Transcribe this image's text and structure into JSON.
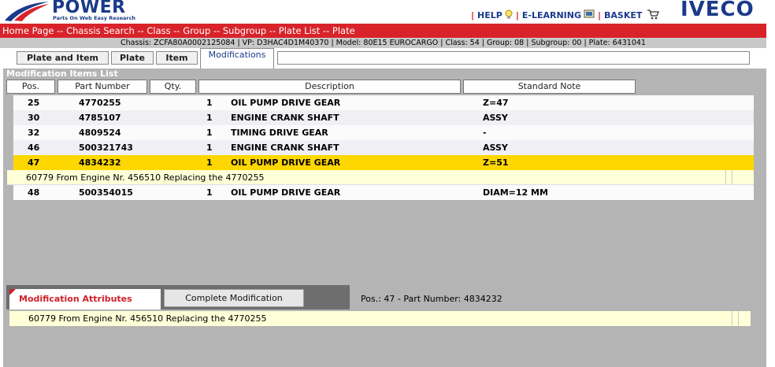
{
  "header": {
    "logo_text": "POWER",
    "logo_sub": "Parts On Web Easy Research",
    "help_label": "HELP",
    "elearning_label": "E-LEARNING",
    "basket_label": "BASKET",
    "brand": "IVECO"
  },
  "breadcrumb": "Home Page -- Chassis Search -- Class -- Group -- Subgroup -- Plate List -- Plate",
  "chassis_info": "Chassis: ZCFA80A0002125084 | VP: D3HAC4D1M40370 | Model: 80E15 EUROCARGO | Class: 54 | Group: 08 | Subgroup: 00 | Plate: 6431041",
  "tabs": [
    {
      "label": "Plate and Item"
    },
    {
      "label": "Plate"
    },
    {
      "label": "Item"
    },
    {
      "label": "Modifications"
    }
  ],
  "list": {
    "title": "Modification Items List",
    "columns": [
      "Pos.",
      "Part Number",
      "Qty.",
      "Description",
      "Standard Note"
    ],
    "rows": [
      {
        "pos": "25",
        "part": "4770255",
        "qty": "1",
        "desc": "OIL PUMP DRIVE GEAR",
        "note": "Z=47"
      },
      {
        "pos": "30",
        "part": "4785107",
        "qty": "1",
        "desc": "ENGINE CRANK SHAFT",
        "note": "ASSY"
      },
      {
        "pos": "32",
        "part": "4809524",
        "qty": "1",
        "desc": "TIMING DRIVE GEAR",
        "note": "-"
      },
      {
        "pos": "46",
        "part": "500321743",
        "qty": "1",
        "desc": "ENGINE CRANK SHAFT",
        "note": "ASSY"
      },
      {
        "pos": "47",
        "part": "4834232",
        "qty": "1",
        "desc": "OIL PUMP DRIVE GEAR",
        "note": "Z=51"
      },
      {
        "pos": "48",
        "part": "500354015",
        "qty": "1",
        "desc": "OIL PUMP DRIVE GEAR",
        "note": "DIAM=12 MM"
      }
    ],
    "selected_note": "60779 From Engine Nr. 456510 Replacing the 4770255"
  },
  "attributes": {
    "tab_active": "Modification Attributes",
    "tab_other": "Complete Modification",
    "pos_info": "Pos.:  47 - Part Number:  4834232",
    "text": "60779 From Engine Nr. 456510 Replacing the 4770255"
  },
  "colors": {
    "brand_blue": "#1a3a8a",
    "breadcrumb_red": "#d8232a",
    "selected_yellow": "#ffd700",
    "note_yellow": "#ffffd8",
    "panel_grey": "#b4b4b4"
  }
}
